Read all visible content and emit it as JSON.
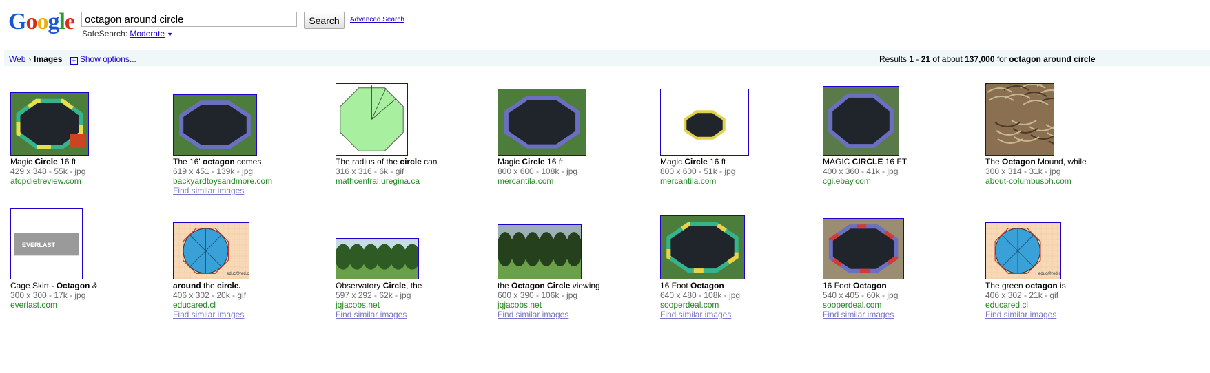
{
  "header": {
    "logo_letters": [
      {
        "ch": "G",
        "color": "#1a57d6"
      },
      {
        "ch": "o",
        "color": "#d62c1a"
      },
      {
        "ch": "o",
        "color": "#e8b00c"
      },
      {
        "ch": "g",
        "color": "#1a57d6"
      },
      {
        "ch": "l",
        "color": "#2c9c2c"
      },
      {
        "ch": "e",
        "color": "#d62c1a"
      }
    ],
    "query": "octagon around circle",
    "search_label": "Search",
    "advanced_label": "Advanced Search",
    "safesearch_label": "SafeSearch:",
    "safesearch_value": "Moderate"
  },
  "subbar": {
    "web_label": "Web",
    "images_label": "Images",
    "show_options_label": "Show options...",
    "results_prefix": "Results ",
    "results_range_start": "1",
    "results_range_sep": " - ",
    "results_range_end": "21",
    "results_of_about": " of about ",
    "results_count": "137,000",
    "results_for": " for ",
    "results_query": "octagon around circle"
  },
  "similar_label": "Find similar images",
  "rows": [
    [
      {
        "title_parts": [
          {
            "t": "Magic "
          },
          {
            "t": "Circle",
            "b": true
          },
          {
            "t": " 16 ft"
          }
        ],
        "meta": "429 x 348 - 55k - jpg",
        "site": "atopdietreview.com",
        "similar": false,
        "thumb": "trampoline-color",
        "img_name": "trampoline-thumbnail"
      },
      {
        "title_parts": [
          {
            "t": "The 16' "
          },
          {
            "t": "octagon",
            "b": true
          },
          {
            "t": " comes"
          }
        ],
        "meta": "619 x 451 - 139k - jpg",
        "site": "backyardtoysandmore.com",
        "similar": true,
        "thumb": "trampoline-blue",
        "img_name": "trampoline-thumbnail"
      },
      {
        "title_parts": [
          {
            "t": "The radius of the "
          },
          {
            "t": "circle",
            "b": true
          },
          {
            "t": " can"
          }
        ],
        "meta": "316 x 316 - 6k - gif",
        "site": "mathcentral.uregina.ca",
        "similar": false,
        "thumb": "octagon-green",
        "img_name": "octagon-diagram-thumbnail"
      },
      {
        "title_parts": [
          {
            "t": "Magic "
          },
          {
            "t": "Circle",
            "b": true
          },
          {
            "t": " 16 ft"
          }
        ],
        "meta": "800 x 600 - 108k - jpg",
        "site": "mercantila.com",
        "similar": false,
        "thumb": "trampoline-blue",
        "img_name": "trampoline-thumbnail"
      },
      {
        "title_parts": [
          {
            "t": "Magic "
          },
          {
            "t": "Circle",
            "b": true
          },
          {
            "t": " 16 ft"
          }
        ],
        "meta": "800 x 600 - 51k - jpg",
        "site": "mercantila.com",
        "similar": false,
        "thumb": "trampoline-small",
        "img_name": "trampoline-thumbnail"
      },
      {
        "title_parts": [
          {
            "t": "MAGIC "
          },
          {
            "t": "CIRCLE",
            "b": true
          },
          {
            "t": " 16 FT"
          }
        ],
        "meta": "400 x 360 - 41k - jpg",
        "site": "cgi.ebay.com",
        "similar": false,
        "thumb": "trampoline-dark",
        "img_name": "trampoline-thumbnail"
      },
      {
        "title_parts": [
          {
            "t": "The "
          },
          {
            "t": "Octagon",
            "b": true
          },
          {
            "t": " Mound, while"
          }
        ],
        "meta": "300 x 314 - 31k - jpg",
        "site": "about-columbusoh.com",
        "similar": false,
        "thumb": "aerial",
        "img_name": "aerial-photo-thumbnail"
      }
    ],
    [
      {
        "title_parts": [
          {
            "t": "Cage Skirt - "
          },
          {
            "t": "Octagon",
            "b": true
          },
          {
            "t": " &"
          }
        ],
        "meta": "300 x 300 - 17k - jpg",
        "site": "everlast.com",
        "similar": false,
        "thumb": "everlast",
        "img_name": "cage-skirt-thumbnail",
        "logo_text": "EVERLAST"
      },
      {
        "title_parts": [
          {
            "t": "around",
            "b": true
          },
          {
            "t": " the "
          },
          {
            "t": "circle.",
            "b": true
          }
        ],
        "meta": "406 x 302 - 20k - gif",
        "site": "educared.cl",
        "similar": true,
        "thumb": "octagon-grid",
        "img_name": "octagon-circle-diagram-thumbnail",
        "credit": "educ@red.cl"
      },
      {
        "title_parts": [
          {
            "t": "Observatory "
          },
          {
            "t": "Circle",
            "b": true
          },
          {
            "t": ", the"
          }
        ],
        "meta": "597 x 292 - 62k - jpg",
        "site": "jqjacobs.net",
        "similar": true,
        "thumb": "landscape",
        "img_name": "landscape-photo-thumbnail"
      },
      {
        "title_parts": [
          {
            "t": "the "
          },
          {
            "t": "Octagon Circle",
            "b": true
          },
          {
            "t": " viewing"
          }
        ],
        "meta": "600 x 390 - 106k - jpg",
        "site": "jqjacobs.net",
        "similar": true,
        "thumb": "landscape-dark",
        "img_name": "landscape-photo-thumbnail"
      },
      {
        "title_parts": [
          {
            "t": "16 Foot "
          },
          {
            "t": "Octagon",
            "b": true
          }
        ],
        "meta": "640 x 480 - 108k - jpg",
        "site": "sooperdeal.com",
        "similar": true,
        "thumb": "trampoline-color2",
        "img_name": "trampoline-thumbnail"
      },
      {
        "title_parts": [
          {
            "t": "16 Foot "
          },
          {
            "t": "Octagon",
            "b": true
          }
        ],
        "meta": "540 x 405 - 60k - jpg",
        "site": "sooperdeal.com",
        "similar": true,
        "thumb": "trampoline-indoor",
        "img_name": "trampoline-thumbnail"
      },
      {
        "title_parts": [
          {
            "t": "The green "
          },
          {
            "t": "octagon",
            "b": true
          },
          {
            "t": " is"
          }
        ],
        "meta": "406 x 302 - 21k - gif",
        "site": "educared.cl",
        "similar": true,
        "thumb": "octagon-grid",
        "img_name": "octagon-circle-diagram-thumbnail",
        "credit": "educ@red.cl"
      }
    ]
  ]
}
